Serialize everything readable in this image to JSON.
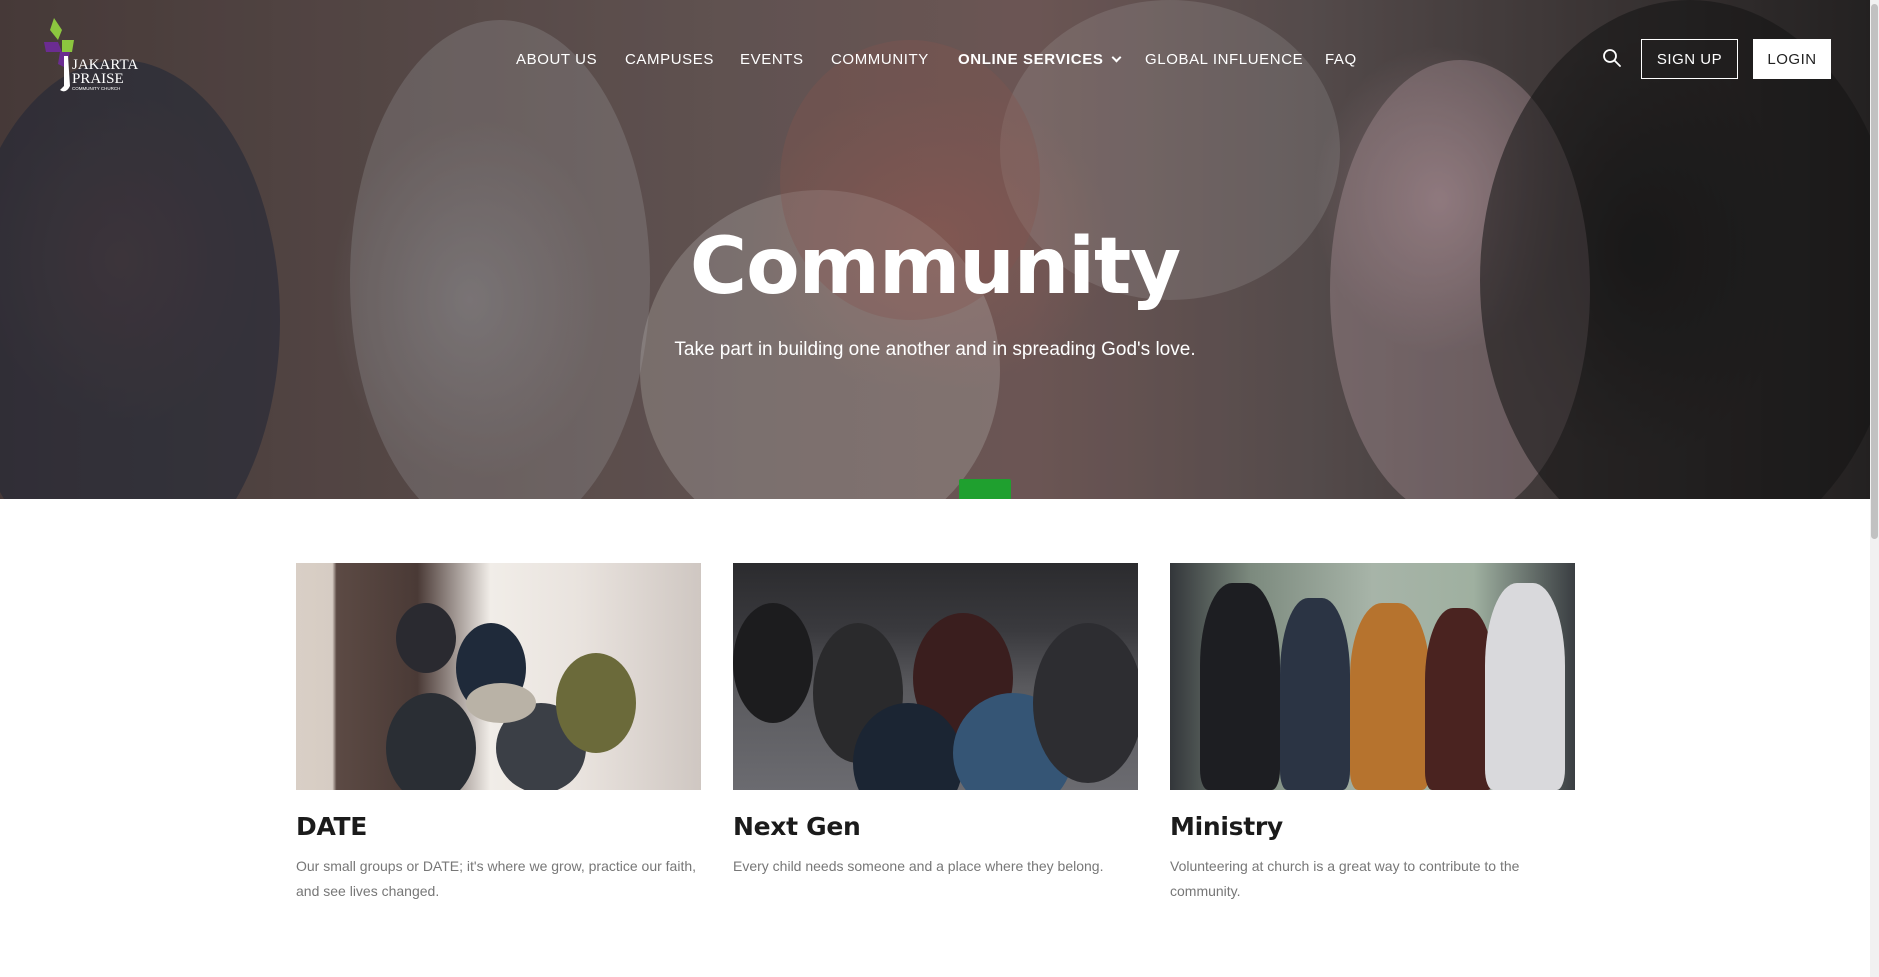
{
  "brand": {
    "logo_line1": "JAKARTA",
    "logo_line2": "PRAISE",
    "logo_line3": "COMMUNITY CHURCH",
    "accent_green": "#8cc63f",
    "accent_purple": "#6b2c91"
  },
  "nav": {
    "items": [
      {
        "label": "ABOUT US"
      },
      {
        "label": "CAMPUSES"
      },
      {
        "label": "EVENTS"
      },
      {
        "label": "COMMUNITY"
      },
      {
        "label": "ONLINE SERVICES"
      },
      {
        "label": "GLOBAL INFLUENCE"
      },
      {
        "label": "FAQ"
      }
    ],
    "search_icon": "search-icon",
    "signup_label": "SIGN UP",
    "login_label": "LOGIN"
  },
  "hero": {
    "title": "Community",
    "subtitle": "Take part in building one another and in spreading God's love."
  },
  "cards": [
    {
      "title": "DATE",
      "description": "Our small groups or DATE; it's where we grow, practice our faith, and see lives changed."
    },
    {
      "title": "Next Gen",
      "description": "Every child needs someone and a place where they belong."
    },
    {
      "title": "Ministry",
      "description": "Volunteering at church is a great way to contribute to the community."
    }
  ]
}
